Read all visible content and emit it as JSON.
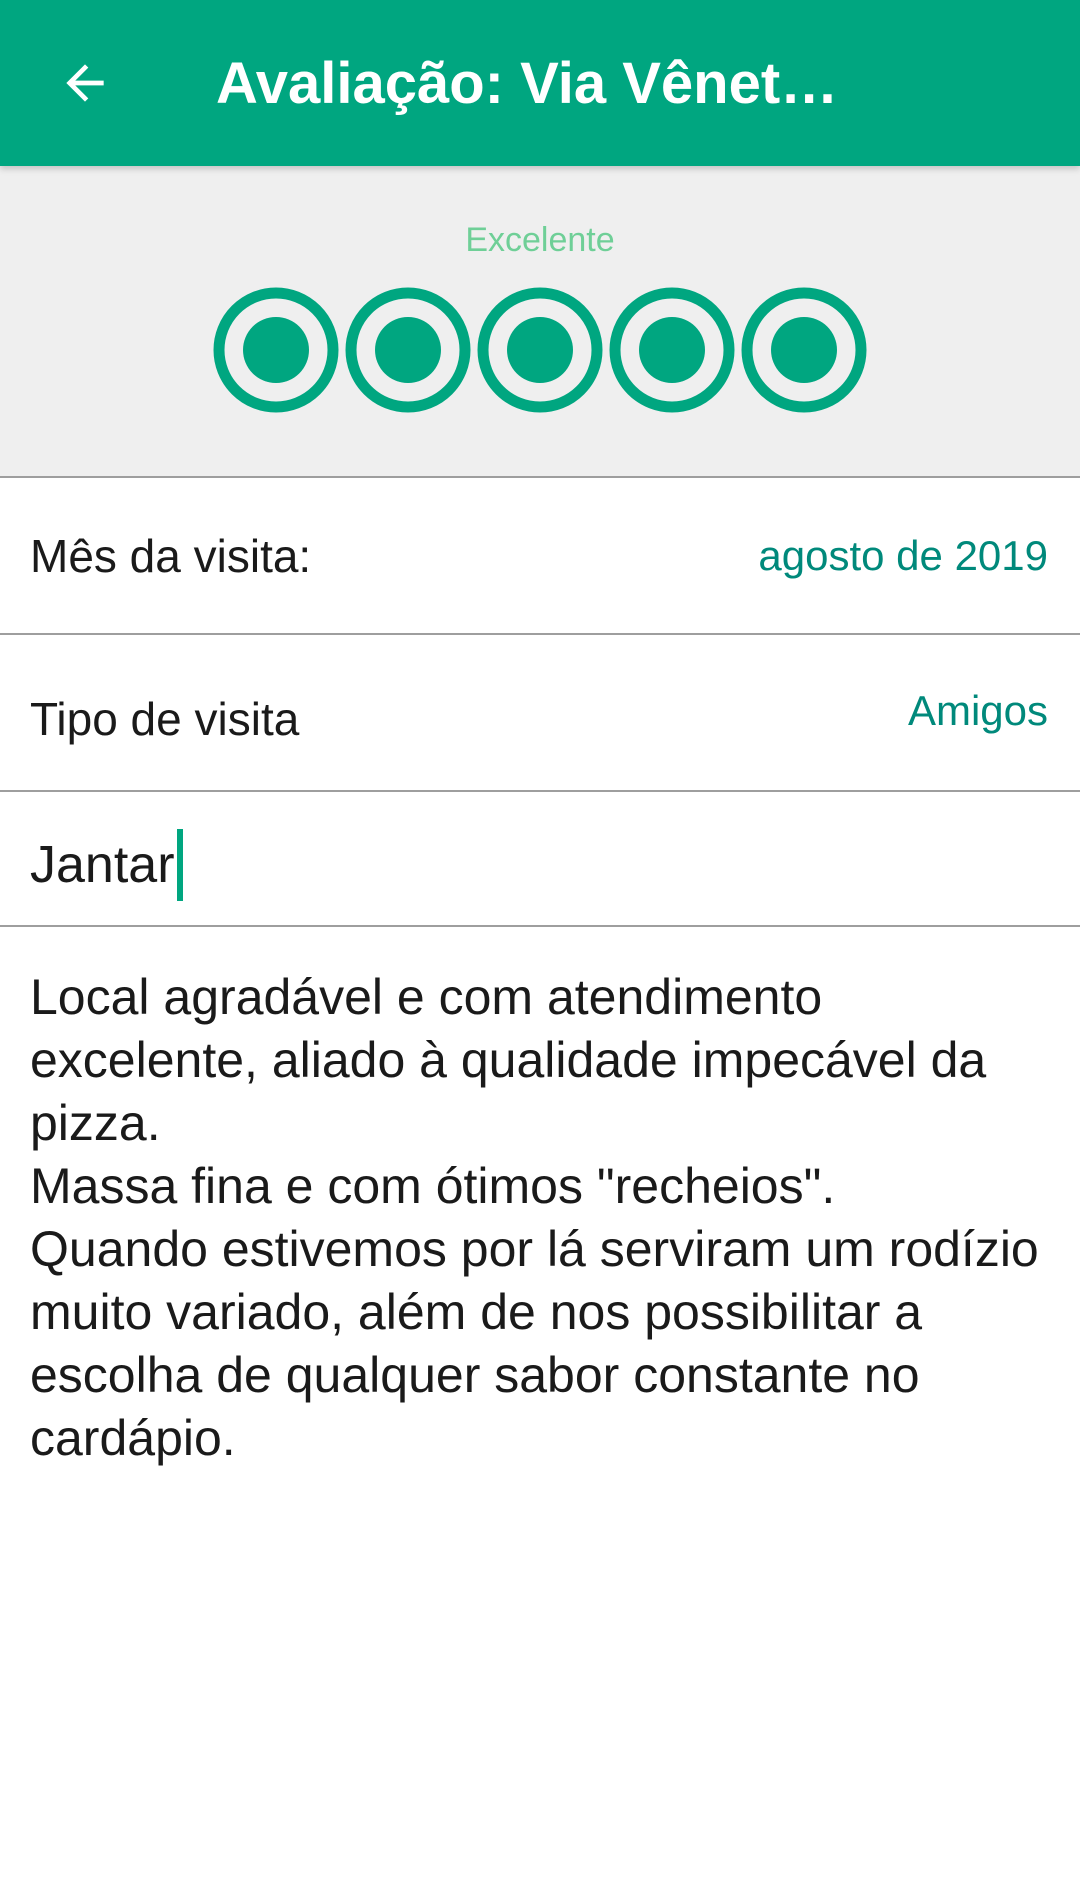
{
  "header": {
    "title": "Avaliação: Via Vênet…",
    "back_icon": "arrow-left-icon",
    "background_color": "#00a680"
  },
  "rating": {
    "label": "Excelente",
    "value": 5,
    "max": 5,
    "icon": "rating-bubble-icon",
    "color": "#00a680"
  },
  "visit_month": {
    "label": "Mês da visita:",
    "value": "agosto de 2019"
  },
  "visit_type": {
    "label": "Tipo de visita",
    "value": "Amigos"
  },
  "review_title": {
    "value": "Jantar"
  },
  "review_text": {
    "value": "Local agradável e com atendimento excelente, aliado à qualidade impecável da pizza.\nMassa fina e com ótimos \"recheios\".\nQuando estivemos por lá serviram um rodízio muito variado, além de nos possibilitar a escolha de qualquer sabor constante no cardápio."
  }
}
